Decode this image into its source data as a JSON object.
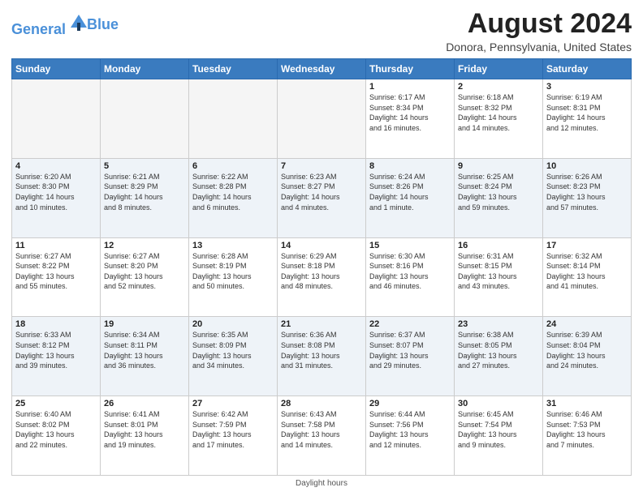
{
  "header": {
    "logo_line1": "General",
    "logo_line2": "Blue",
    "month_title": "August 2024",
    "location": "Donora, Pennsylvania, United States"
  },
  "days_of_week": [
    "Sunday",
    "Monday",
    "Tuesday",
    "Wednesday",
    "Thursday",
    "Friday",
    "Saturday"
  ],
  "footer": {
    "daylight_label": "Daylight hours"
  },
  "weeks": [
    [
      {
        "num": "",
        "info": ""
      },
      {
        "num": "",
        "info": ""
      },
      {
        "num": "",
        "info": ""
      },
      {
        "num": "",
        "info": ""
      },
      {
        "num": "1",
        "info": "Sunrise: 6:17 AM\nSunset: 8:34 PM\nDaylight: 14 hours\nand 16 minutes."
      },
      {
        "num": "2",
        "info": "Sunrise: 6:18 AM\nSunset: 8:32 PM\nDaylight: 14 hours\nand 14 minutes."
      },
      {
        "num": "3",
        "info": "Sunrise: 6:19 AM\nSunset: 8:31 PM\nDaylight: 14 hours\nand 12 minutes."
      }
    ],
    [
      {
        "num": "4",
        "info": "Sunrise: 6:20 AM\nSunset: 8:30 PM\nDaylight: 14 hours\nand 10 minutes."
      },
      {
        "num": "5",
        "info": "Sunrise: 6:21 AM\nSunset: 8:29 PM\nDaylight: 14 hours\nand 8 minutes."
      },
      {
        "num": "6",
        "info": "Sunrise: 6:22 AM\nSunset: 8:28 PM\nDaylight: 14 hours\nand 6 minutes."
      },
      {
        "num": "7",
        "info": "Sunrise: 6:23 AM\nSunset: 8:27 PM\nDaylight: 14 hours\nand 4 minutes."
      },
      {
        "num": "8",
        "info": "Sunrise: 6:24 AM\nSunset: 8:26 PM\nDaylight: 14 hours\nand 1 minute."
      },
      {
        "num": "9",
        "info": "Sunrise: 6:25 AM\nSunset: 8:24 PM\nDaylight: 13 hours\nand 59 minutes."
      },
      {
        "num": "10",
        "info": "Sunrise: 6:26 AM\nSunset: 8:23 PM\nDaylight: 13 hours\nand 57 minutes."
      }
    ],
    [
      {
        "num": "11",
        "info": "Sunrise: 6:27 AM\nSunset: 8:22 PM\nDaylight: 13 hours\nand 55 minutes."
      },
      {
        "num": "12",
        "info": "Sunrise: 6:27 AM\nSunset: 8:20 PM\nDaylight: 13 hours\nand 52 minutes."
      },
      {
        "num": "13",
        "info": "Sunrise: 6:28 AM\nSunset: 8:19 PM\nDaylight: 13 hours\nand 50 minutes."
      },
      {
        "num": "14",
        "info": "Sunrise: 6:29 AM\nSunset: 8:18 PM\nDaylight: 13 hours\nand 48 minutes."
      },
      {
        "num": "15",
        "info": "Sunrise: 6:30 AM\nSunset: 8:16 PM\nDaylight: 13 hours\nand 46 minutes."
      },
      {
        "num": "16",
        "info": "Sunrise: 6:31 AM\nSunset: 8:15 PM\nDaylight: 13 hours\nand 43 minutes."
      },
      {
        "num": "17",
        "info": "Sunrise: 6:32 AM\nSunset: 8:14 PM\nDaylight: 13 hours\nand 41 minutes."
      }
    ],
    [
      {
        "num": "18",
        "info": "Sunrise: 6:33 AM\nSunset: 8:12 PM\nDaylight: 13 hours\nand 39 minutes."
      },
      {
        "num": "19",
        "info": "Sunrise: 6:34 AM\nSunset: 8:11 PM\nDaylight: 13 hours\nand 36 minutes."
      },
      {
        "num": "20",
        "info": "Sunrise: 6:35 AM\nSunset: 8:09 PM\nDaylight: 13 hours\nand 34 minutes."
      },
      {
        "num": "21",
        "info": "Sunrise: 6:36 AM\nSunset: 8:08 PM\nDaylight: 13 hours\nand 31 minutes."
      },
      {
        "num": "22",
        "info": "Sunrise: 6:37 AM\nSunset: 8:07 PM\nDaylight: 13 hours\nand 29 minutes."
      },
      {
        "num": "23",
        "info": "Sunrise: 6:38 AM\nSunset: 8:05 PM\nDaylight: 13 hours\nand 27 minutes."
      },
      {
        "num": "24",
        "info": "Sunrise: 6:39 AM\nSunset: 8:04 PM\nDaylight: 13 hours\nand 24 minutes."
      }
    ],
    [
      {
        "num": "25",
        "info": "Sunrise: 6:40 AM\nSunset: 8:02 PM\nDaylight: 13 hours\nand 22 minutes."
      },
      {
        "num": "26",
        "info": "Sunrise: 6:41 AM\nSunset: 8:01 PM\nDaylight: 13 hours\nand 19 minutes."
      },
      {
        "num": "27",
        "info": "Sunrise: 6:42 AM\nSunset: 7:59 PM\nDaylight: 13 hours\nand 17 minutes."
      },
      {
        "num": "28",
        "info": "Sunrise: 6:43 AM\nSunset: 7:58 PM\nDaylight: 13 hours\nand 14 minutes."
      },
      {
        "num": "29",
        "info": "Sunrise: 6:44 AM\nSunset: 7:56 PM\nDaylight: 13 hours\nand 12 minutes."
      },
      {
        "num": "30",
        "info": "Sunrise: 6:45 AM\nSunset: 7:54 PM\nDaylight: 13 hours\nand 9 minutes."
      },
      {
        "num": "31",
        "info": "Sunrise: 6:46 AM\nSunset: 7:53 PM\nDaylight: 13 hours\nand 7 minutes."
      }
    ]
  ]
}
